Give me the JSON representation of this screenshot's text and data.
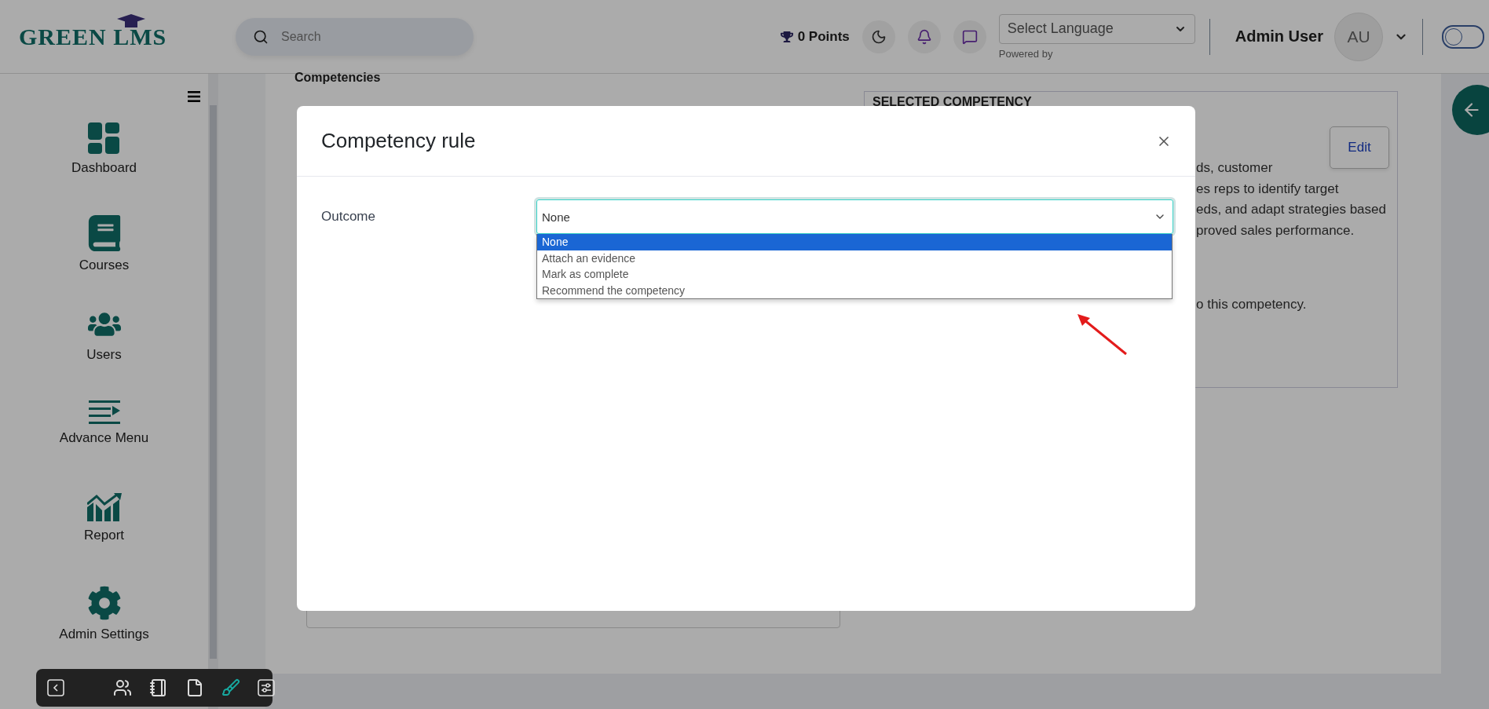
{
  "header": {
    "logo": "GREEN LMS",
    "search": {
      "placeholder": "Search"
    },
    "points": "0 Points",
    "language_select": {
      "value": "Select Language"
    },
    "powered_by": "Powered by",
    "user_name": "Admin User",
    "avatar_initials": "AU",
    "theme_toggle": {
      "on": false
    }
  },
  "sidebar": {
    "items": [
      {
        "kind": "dashboard",
        "label": "Dashboard"
      },
      {
        "kind": "courses",
        "label": "Courses"
      },
      {
        "kind": "users",
        "label": "Users"
      },
      {
        "kind": "menu",
        "label": "Advance Menu"
      },
      {
        "kind": "report",
        "label": "Report"
      },
      {
        "kind": "settings",
        "label": "Admin Settings"
      }
    ]
  },
  "page": {
    "section_title": "Competencies",
    "selected_panel": {
      "heading": "SELECTED COMPETENCY",
      "edit_button": "Edit",
      "lines": [
        "ds, customer",
        "es reps to identify target",
        "eds, and adapt strategies based",
        "proved sales performance.",
        "o this competency."
      ]
    }
  },
  "modal": {
    "title": "Competency rule",
    "field_label": "Outcome",
    "select": {
      "value": "None",
      "expanded": true,
      "options": [
        {
          "label": "None",
          "selected": true
        },
        {
          "label": "Attach an evidence",
          "selected": false
        },
        {
          "label": "Mark as complete",
          "selected": false
        },
        {
          "label": "Recommend the competency",
          "selected": false
        }
      ]
    }
  },
  "toolbar": {
    "items": [
      {
        "kind": "back",
        "selected": false
      },
      {
        "kind": "users",
        "selected": false
      },
      {
        "kind": "notebook",
        "selected": false
      },
      {
        "kind": "file",
        "selected": false
      },
      {
        "kind": "brush",
        "selected": true
      },
      {
        "kind": "sliders",
        "selected": false
      }
    ]
  }
}
